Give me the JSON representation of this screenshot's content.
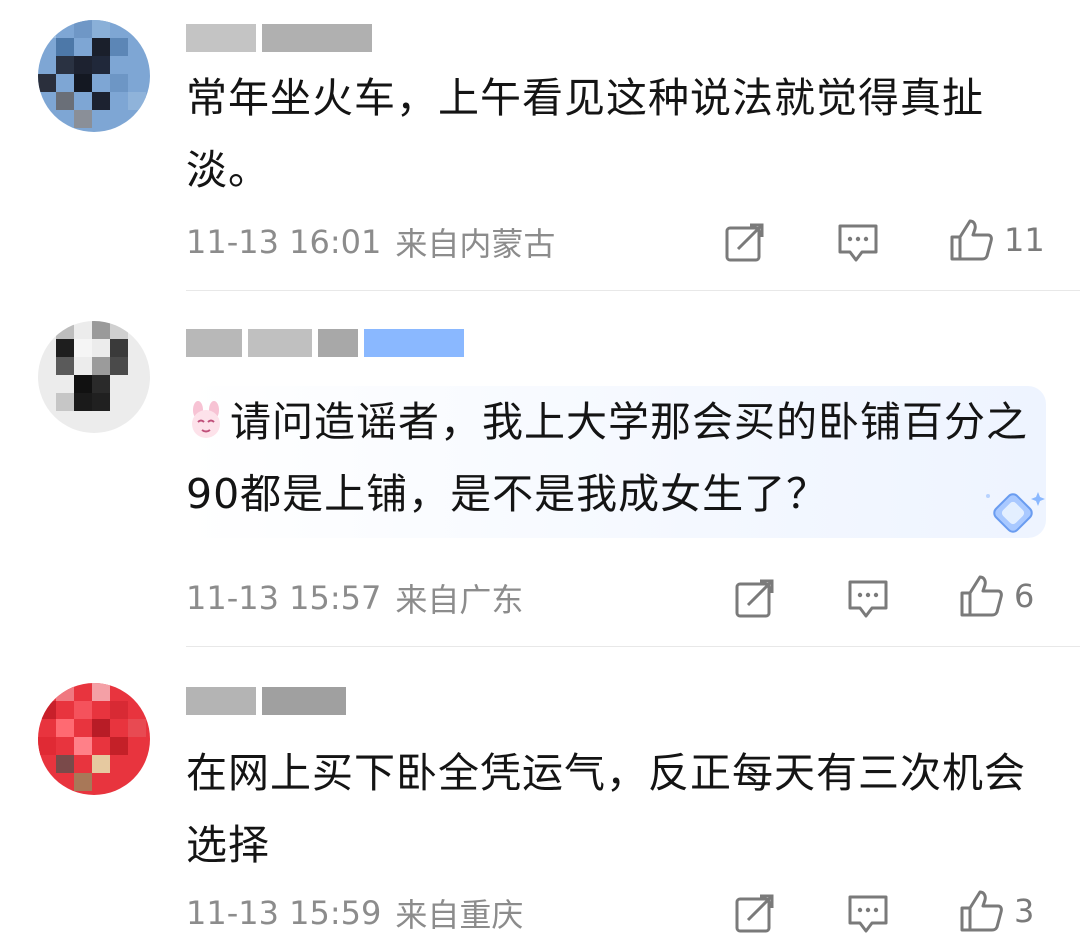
{
  "comments": [
    {
      "text": "常年坐火车，上午看见这种说法就觉得真扯淡。",
      "time": "11-13 16:01",
      "location": "来自内蒙古",
      "likes": "11",
      "avatar_color": "#6f9ac9"
    },
    {
      "text": "请问造谣者，我上大学那会买的卧铺百分之90都是上铺，是不是我成女生了？",
      "time": "11-13 15:57",
      "location": "来自广东",
      "likes": "6",
      "avatar_color": "#d9d9d9",
      "emoji": "bunny-emoji",
      "badge_color": "#8ab8ff"
    },
    {
      "text": "在网上买下卧全凭运气，反正每天有三次机会选择",
      "time": "11-13 15:59",
      "location": "来自重庆",
      "likes": "3",
      "avatar_color": "#e0303a"
    }
  ],
  "icons": {
    "share": "share-icon",
    "reply": "reply-icon",
    "like": "thumbs-up-icon"
  }
}
